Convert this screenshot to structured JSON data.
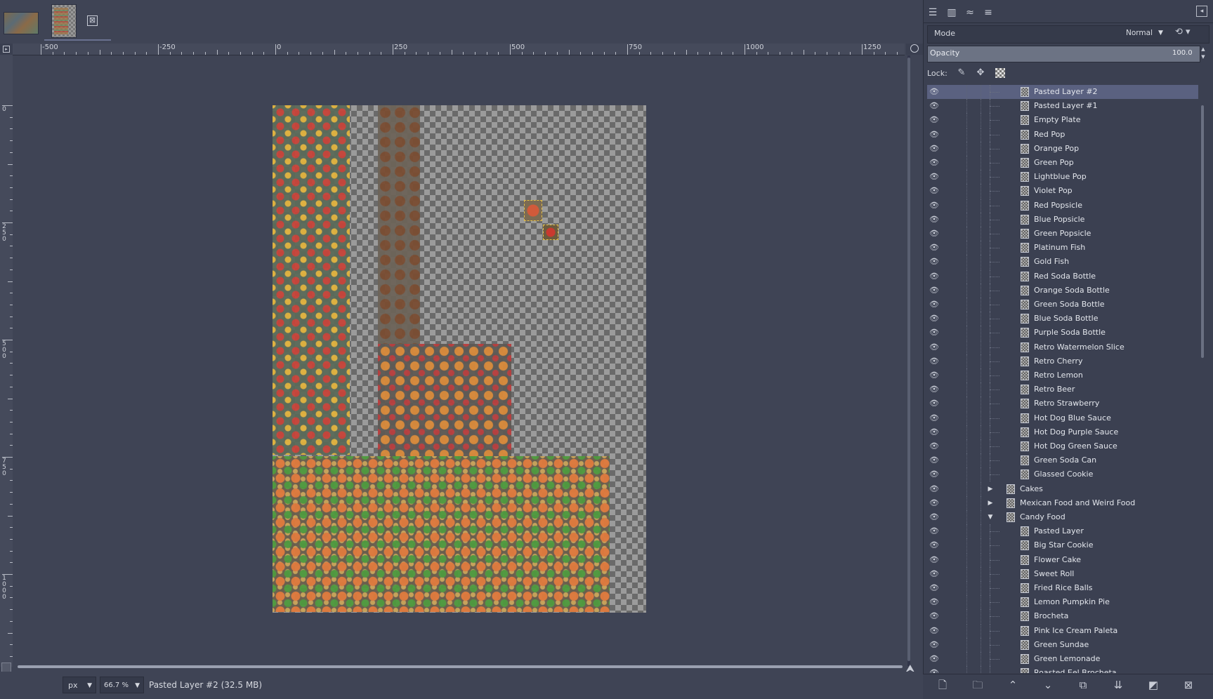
{
  "image_tabs": {
    "close_symbol": "⊠"
  },
  "ruler": {
    "h_labels": [
      "-500",
      "-250",
      "0",
      "250",
      "500",
      "750",
      "1000",
      "1250"
    ],
    "v_labels": [
      "0",
      "250",
      "500",
      "750",
      "1000"
    ]
  },
  "statusbar": {
    "unit": "px",
    "zoom": "66.7 %",
    "message": "Pasted Layer #2 (32.5 MB)"
  },
  "dock": {
    "tab_icons": [
      "layers-icon",
      "channels-icon",
      "paths-icon",
      "undo-history-icon"
    ],
    "mode_label": "Mode",
    "mode_value": "Normal",
    "opacity_label": "Opacity",
    "opacity_value": "100.0",
    "lock_label": "Lock:",
    "layers": [
      {
        "name": "Pasted Layer #2",
        "kind": "child",
        "selected": true
      },
      {
        "name": "Pasted Layer #1",
        "kind": "child"
      },
      {
        "name": "Empty Plate",
        "kind": "child"
      },
      {
        "name": "Red Pop",
        "kind": "child"
      },
      {
        "name": "Orange Pop",
        "kind": "child"
      },
      {
        "name": "Green Pop",
        "kind": "child"
      },
      {
        "name": "Lightblue Pop",
        "kind": "child"
      },
      {
        "name": "Violet Pop",
        "kind": "child"
      },
      {
        "name": "Red Popsicle",
        "kind": "child"
      },
      {
        "name": "Blue Popsicle",
        "kind": "child"
      },
      {
        "name": "Green Popsicle",
        "kind": "child"
      },
      {
        "name": "Platinum Fish",
        "kind": "child"
      },
      {
        "name": "Gold Fish",
        "kind": "child"
      },
      {
        "name": "Red Soda Bottle",
        "kind": "child"
      },
      {
        "name": "Orange Soda Bottle",
        "kind": "child"
      },
      {
        "name": "Green Soda Bottle",
        "kind": "child"
      },
      {
        "name": "Blue Soda Bottle",
        "kind": "child"
      },
      {
        "name": "Purple Soda Bottle",
        "kind": "child"
      },
      {
        "name": "Retro Watermelon Slice",
        "kind": "child"
      },
      {
        "name": "Retro Cherry",
        "kind": "child"
      },
      {
        "name": "Retro Lemon",
        "kind": "child"
      },
      {
        "name": "Retro Beer",
        "kind": "child"
      },
      {
        "name": "Retro Strawberry",
        "kind": "child"
      },
      {
        "name": "Hot Dog Blue Sauce",
        "kind": "child"
      },
      {
        "name": "Hot Dog Purple Sauce",
        "kind": "child"
      },
      {
        "name": "Hot Dog Green Sauce",
        "kind": "child"
      },
      {
        "name": "Green Soda Can",
        "kind": "child"
      },
      {
        "name": "Glassed Cookie",
        "kind": "child"
      },
      {
        "name": "Cakes",
        "kind": "group",
        "expanded": false
      },
      {
        "name": "Mexican Food and Weird Food",
        "kind": "group",
        "expanded": false
      },
      {
        "name": "Candy Food",
        "kind": "group",
        "expanded": true
      },
      {
        "name": "Pasted Layer",
        "kind": "child"
      },
      {
        "name": "Big Star Cookie",
        "kind": "child"
      },
      {
        "name": "Flower Cake",
        "kind": "child"
      },
      {
        "name": "Sweet Roll",
        "kind": "child"
      },
      {
        "name": "Fried Rice Balls",
        "kind": "child"
      },
      {
        "name": "Lemon Pumpkin Pie",
        "kind": "child"
      },
      {
        "name": "Brocheta",
        "kind": "child"
      },
      {
        "name": "Pink Ice Cream Paleta",
        "kind": "child"
      },
      {
        "name": "Green Sundae",
        "kind": "child"
      },
      {
        "name": "Green Lemonade",
        "kind": "child"
      },
      {
        "name": "Roasted Eel Brocheta",
        "kind": "child"
      }
    ],
    "bottom_buttons": [
      "new-layer-icon",
      "new-group-icon",
      "raise-layer-icon",
      "lower-layer-icon",
      "duplicate-layer-icon",
      "merge-down-icon",
      "layer-mask-icon",
      "delete-layer-icon"
    ]
  }
}
